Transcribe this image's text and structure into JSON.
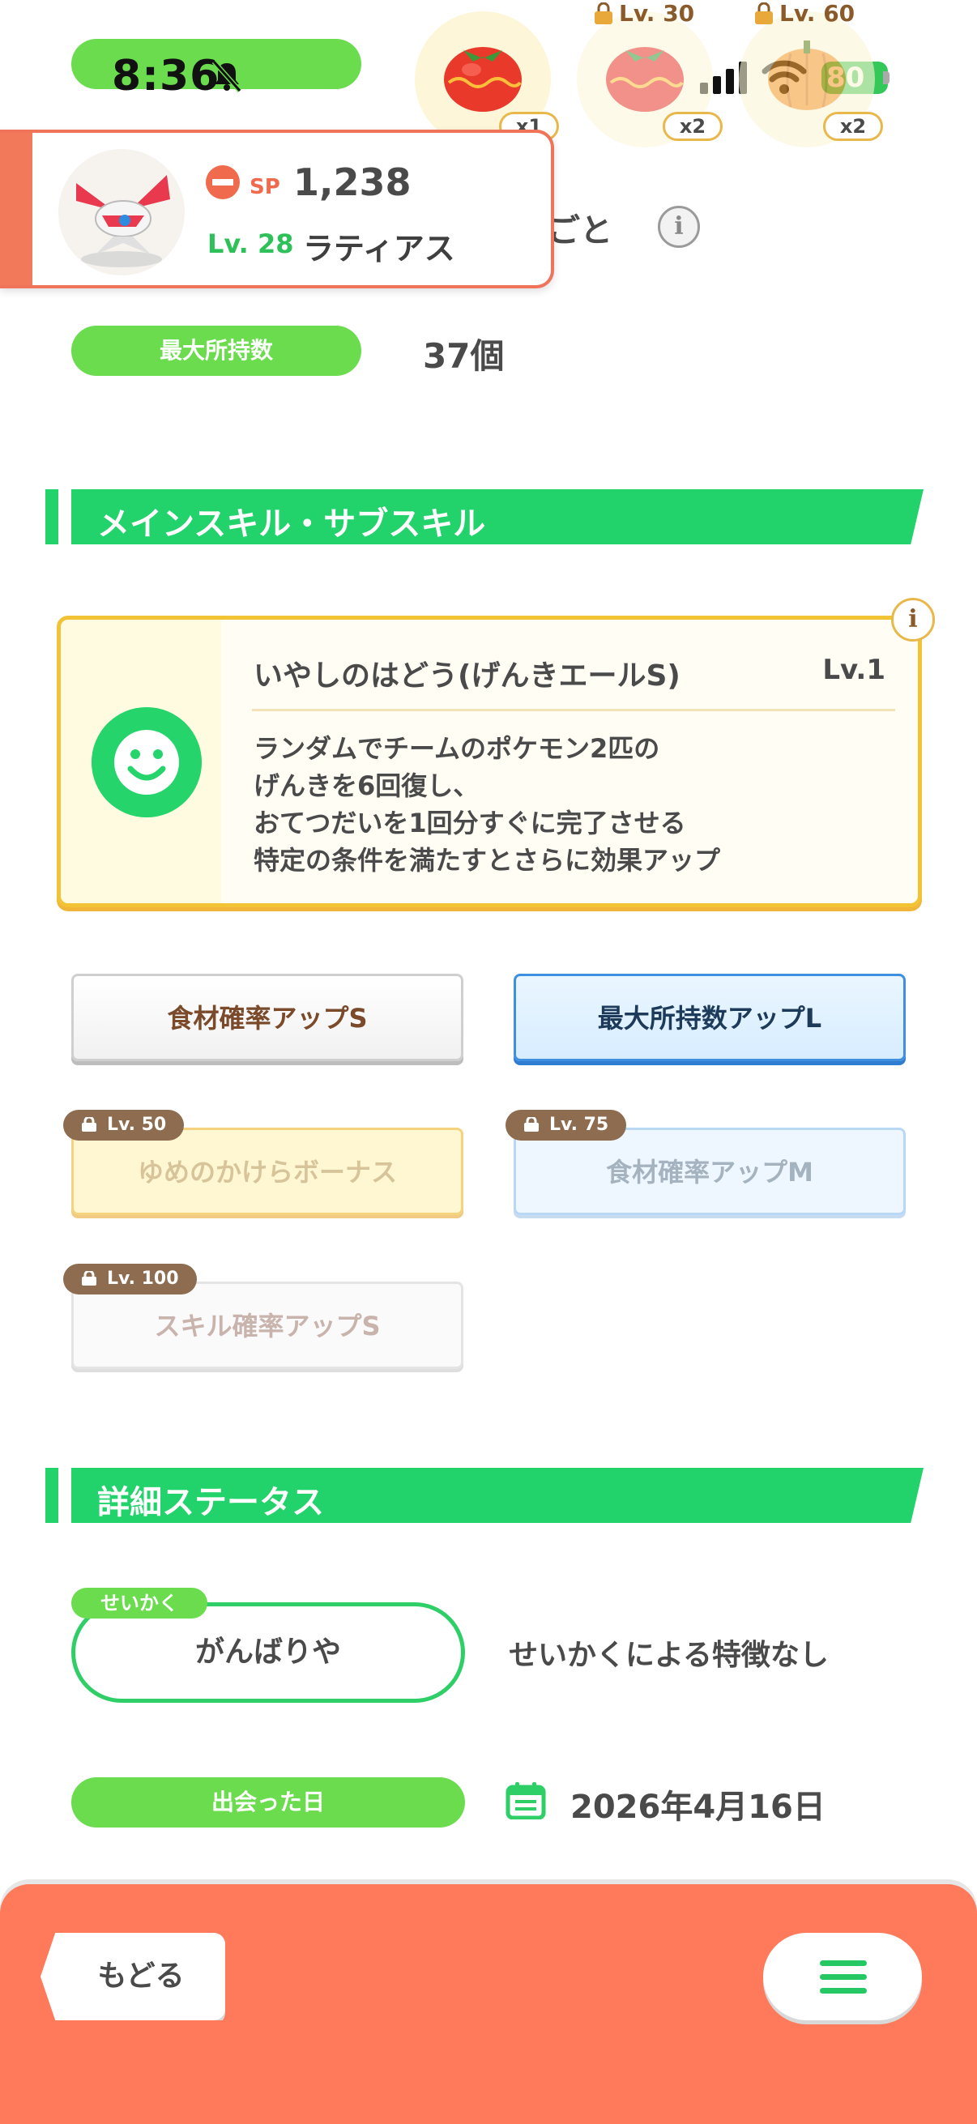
{
  "status_bar": {
    "time": "8:36",
    "battery": "80"
  },
  "ingredients": [
    {
      "name": "tomato",
      "count": "x1",
      "lock_label": ""
    },
    {
      "name": "tomato",
      "count": "x2",
      "lock_label": "Lv. 30"
    },
    {
      "name": "pumpkin",
      "count": "x2",
      "lock_label": "Lv. 60"
    }
  ],
  "pokemon_card": {
    "sp_label": "SP",
    "sp_value": "1,238",
    "level": "Lv. 28",
    "name": "ラティアス"
  },
  "hidden_section_title": "ごと",
  "max_carry": {
    "label": "最大所持数",
    "value": "37個"
  },
  "skills_section": {
    "title": "メインスキル・サブスキル",
    "main_skill": {
      "name": "いやしのはどう(げんきエールS)",
      "level": "Lv.1",
      "description_lines": [
        "ランダムでチームのポケモン2匹の",
        "げんきを6回復し、",
        "おてつだいを1回分すぐに完了させる",
        "特定の条件を満たすとさらに効果アップ"
      ]
    },
    "sub_skills": [
      {
        "label": "食材確率アップS",
        "lock": ""
      },
      {
        "label": "最大所持数アップL",
        "lock": ""
      },
      {
        "label": "ゆめのかけらボーナス",
        "lock": "Lv. 50"
      },
      {
        "label": "食材確率アップM",
        "lock": "Lv. 75"
      },
      {
        "label": "スキル確率アップS",
        "lock": "Lv. 100"
      }
    ]
  },
  "detail_section": {
    "title": "詳細ステータス",
    "nature_tag": "せいかく",
    "nature": "がんばりや",
    "nature_desc": "せいかくによる特徴なし",
    "met_date_label": "出会った日",
    "met_date": "2026年4月16日"
  },
  "bottom_bar": {
    "back_label": "もどる"
  },
  "colors": {
    "accent_green": "#22d26a",
    "pill_green": "#6bdc4e",
    "footer_orange": "#ff7a5a"
  }
}
